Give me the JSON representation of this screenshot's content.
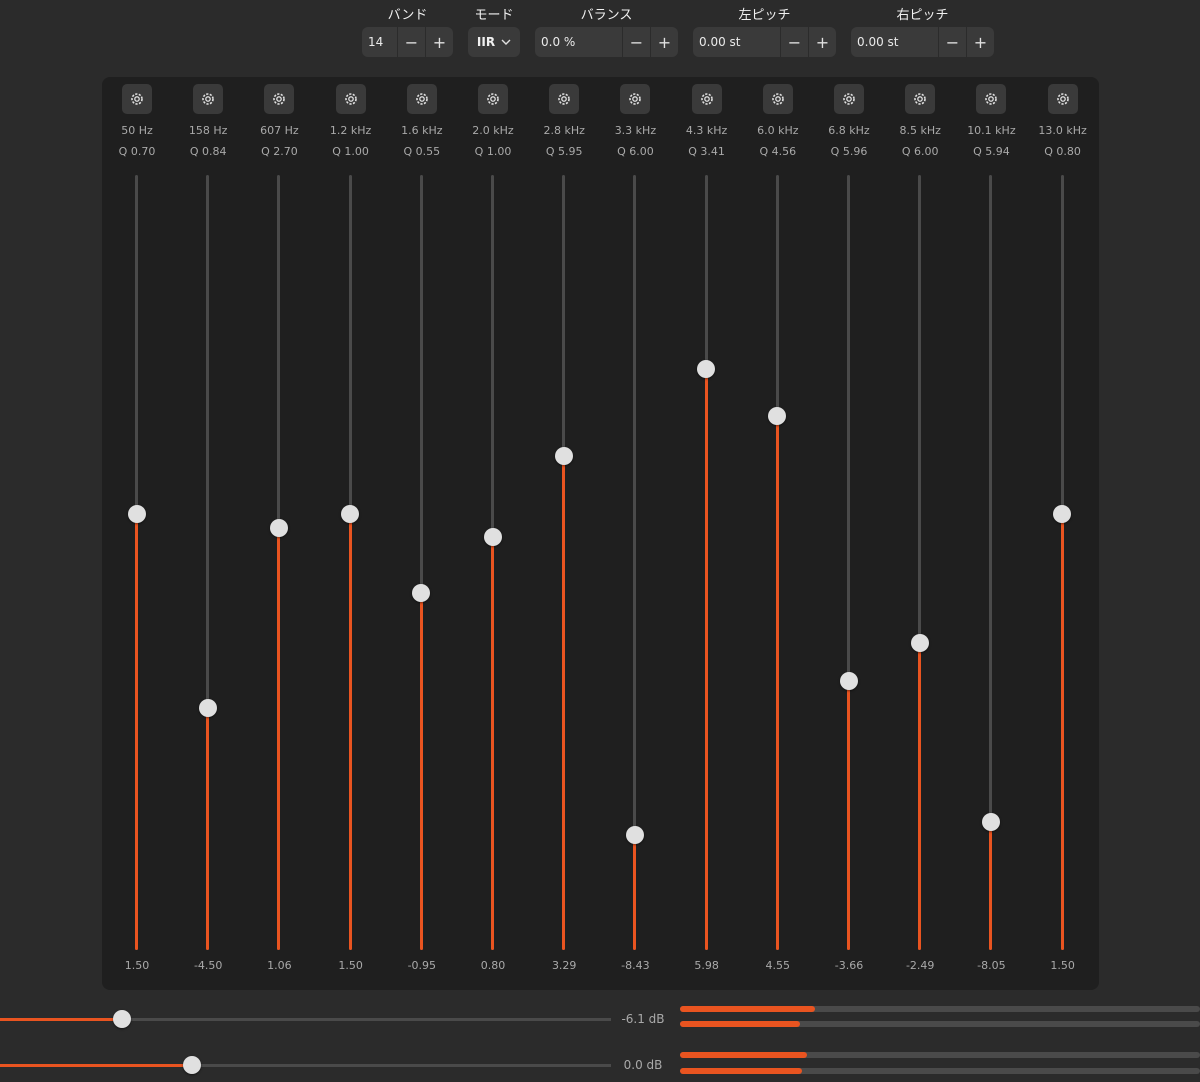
{
  "controls": {
    "bands": {
      "label": "バンド",
      "value": "14"
    },
    "mode": {
      "label": "モード",
      "value": "IIR"
    },
    "balance": {
      "label": "バランス",
      "value": "0.0 %"
    },
    "left_pitch": {
      "label": "左ピッチ",
      "value": "0.00 st"
    },
    "right_pitch": {
      "label": "右ピッチ",
      "value": "0.00 st"
    },
    "minus": "−",
    "plus": "+"
  },
  "eq_range": {
    "min": -12,
    "max": 12
  },
  "bands": [
    {
      "freq": "50 Hz",
      "q": "Q 0.70",
      "gain": "1.50",
      "value": 1.5
    },
    {
      "freq": "158 Hz",
      "q": "Q 0.84",
      "gain": "-4.50",
      "value": -4.5
    },
    {
      "freq": "607 Hz",
      "q": "Q 2.70",
      "gain": "1.06",
      "value": 1.06
    },
    {
      "freq": "1.2 kHz",
      "q": "Q 1.00",
      "gain": "1.50",
      "value": 1.5
    },
    {
      "freq": "1.6 kHz",
      "q": "Q 0.55",
      "gain": "-0.95",
      "value": -0.95
    },
    {
      "freq": "2.0 kHz",
      "q": "Q 1.00",
      "gain": "0.80",
      "value": 0.8
    },
    {
      "freq": "2.8 kHz",
      "q": "Q 5.95",
      "gain": "3.29",
      "value": 3.29
    },
    {
      "freq": "3.3 kHz",
      "q": "Q 6.00",
      "gain": "-8.43",
      "value": -8.43
    },
    {
      "freq": "4.3 kHz",
      "q": "Q 3.41",
      "gain": "5.98",
      "value": 5.98
    },
    {
      "freq": "6.0 kHz",
      "q": "Q 4.56",
      "gain": "4.55",
      "value": 4.55
    },
    {
      "freq": "6.8 kHz",
      "q": "Q 5.96",
      "gain": "-3.66",
      "value": -3.66
    },
    {
      "freq": "8.5 kHz",
      "q": "Q 6.00",
      "gain": "-2.49",
      "value": -2.49
    },
    {
      "freq": "10.1 kHz",
      "q": "Q 5.94",
      "gain": "-8.05",
      "value": -8.05
    },
    {
      "freq": "13.0 kHz",
      "q": "Q 0.80",
      "gain": "1.50",
      "value": 1.5
    }
  ],
  "gain_sliders": [
    {
      "label": "-6.1 dB",
      "level": 0.2,
      "meters": [
        0.26,
        0.23
      ]
    },
    {
      "label": "0.0 dB",
      "level": 0.315,
      "meters": [
        0.245,
        0.235
      ]
    }
  ],
  "colors": {
    "accent": "#e95420",
    "panel": "#1f1f1f",
    "background": "#2b2b2b"
  },
  "icons": {
    "band_settings": "gear-icon",
    "mode_dropdown": "chevron-down-icon"
  }
}
